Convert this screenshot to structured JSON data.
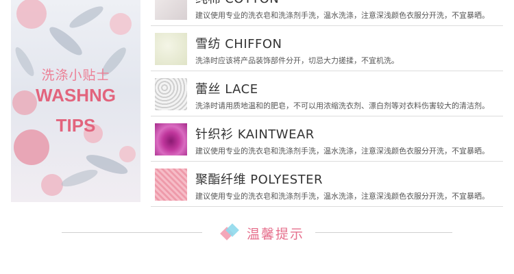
{
  "tips_panel": {
    "title_cn": "洗涤小贴士",
    "title_en_line1": "WASHNG",
    "title_en_line2": "TIPS"
  },
  "fabrics": [
    {
      "name": "纯棉 COTTON",
      "desc": "建议使用专业的洗衣皂和洗涤剂手洗，温水洗涤，注意深浅颜色衣服分开洗，不宜暴晒。",
      "swatch_color": "#e8e2e3"
    },
    {
      "name": "雪纺 CHIFFON",
      "desc": "洗涤时应该将产品装饰部件分开，切忌大力搓揉，不宜机洗。",
      "swatch_color": "#e9ecd6"
    },
    {
      "name": "蕾丝 LACE",
      "desc": "洗涤时请用质地温和的肥皂，不可以用浓缩洗衣剂、漂白剂等对衣料伤害较大的清洁剂。",
      "swatch_color": "#d9d9d9"
    },
    {
      "name": "针织衫 KAINTWEAR",
      "desc": "建议使用专业的洗衣皂和洗涤剂手洗，温水洗涤，注意深浅颜色衣服分开洗，不宜暴晒。",
      "swatch_color": "#c0369c"
    },
    {
      "name": "聚酯纤维 POLYESTER",
      "desc": "建议使用专业的洗衣皂和洗涤剂手洗，温水洗涤，注意深浅颜色衣服分开洗，不宜暴晒。",
      "swatch_color": "#f3a9b7"
    }
  ],
  "notice": {
    "title": "温馨提示",
    "accent_pink": "#f4a7b9",
    "accent_blue": "#8fd9ec"
  }
}
